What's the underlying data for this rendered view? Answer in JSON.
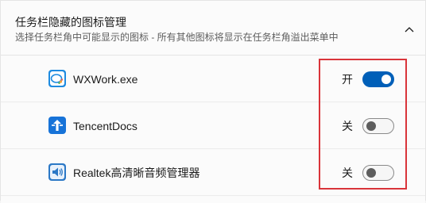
{
  "section": {
    "title": "任务栏隐藏的图标管理",
    "subtitle": "选择任务栏角中可能显示的图标 - 所有其他图标将显示在任务栏角溢出菜单中",
    "collapse_icon": "chevron-up-icon"
  },
  "apps": [
    {
      "name": "WXWork.exe",
      "state": "开",
      "enabled": true,
      "icon": "wxwork-icon",
      "icon_color": "#1e8be0"
    },
    {
      "name": "TencentDocs",
      "state": "关",
      "enabled": false,
      "icon": "tencent-docs-icon",
      "icon_color": "#1773d8"
    },
    {
      "name": "Realtek高清晰音频管理器",
      "state": "关",
      "enabled": false,
      "icon": "speaker-icon",
      "icon_color": "#2b78c6"
    }
  ],
  "colors": {
    "toggle_on": "#005fb8",
    "highlight_box": "#d9343a"
  }
}
